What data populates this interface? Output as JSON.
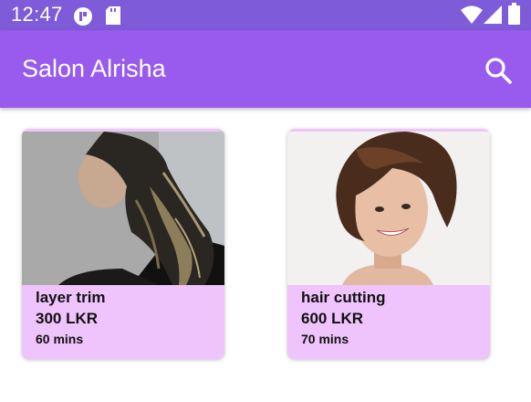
{
  "status_bar": {
    "time": "12:47",
    "icons": [
      "app-notification-icon",
      "sd-card-icon",
      "wifi-icon",
      "signal-icon",
      "battery-icon"
    ]
  },
  "app_bar": {
    "title": "Salon Alrisha",
    "search_icon": "search-icon"
  },
  "colors": {
    "status_bar": "#7e5bd8",
    "app_bar": "#985bed",
    "card_background": "#efc3fb"
  },
  "services": [
    {
      "name": "layer trim",
      "price": "300 LKR",
      "duration": "60 mins",
      "image": "long-layered-hair-photo"
    },
    {
      "name": "hair cutting",
      "price": "600 LKR",
      "duration": "70 mins",
      "image": "short-bob-hair-photo"
    }
  ]
}
